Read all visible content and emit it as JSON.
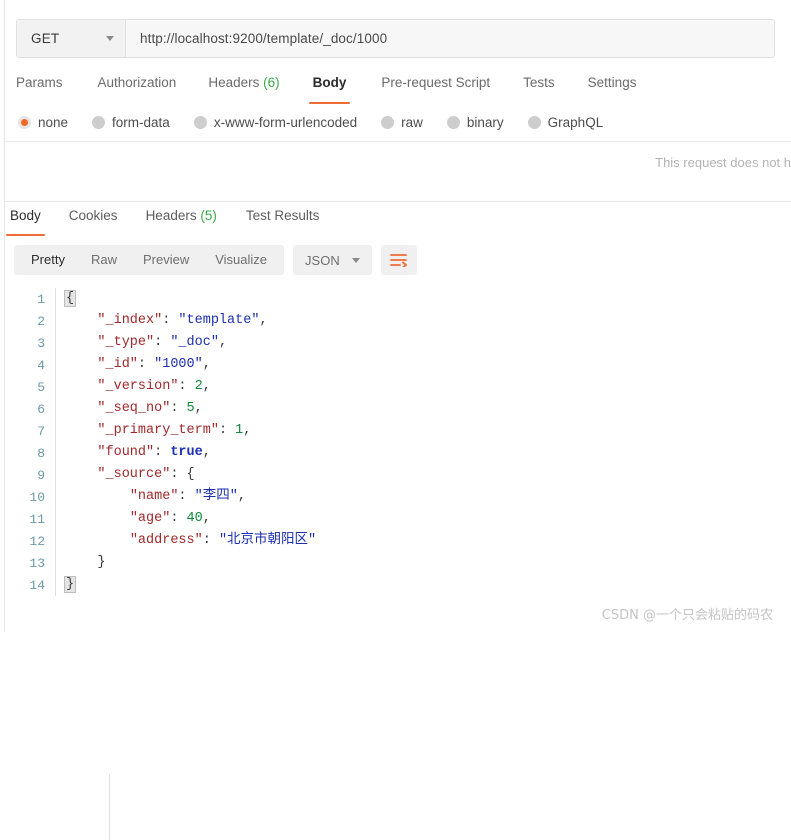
{
  "request": {
    "method": "GET",
    "url": "http://localhost:9200/template/_doc/1000",
    "tabs": [
      {
        "label": "Params",
        "count": "",
        "active": false
      },
      {
        "label": "Authorization",
        "count": "",
        "active": false
      },
      {
        "label": "Headers",
        "count": "(6)",
        "active": false
      },
      {
        "label": "Body",
        "count": "",
        "active": true
      },
      {
        "label": "Pre-request Script",
        "count": "",
        "active": false
      },
      {
        "label": "Tests",
        "count": "",
        "active": false
      },
      {
        "label": "Settings",
        "count": "",
        "active": false
      }
    ],
    "body_modes": [
      {
        "label": "none",
        "selected": true
      },
      {
        "label": "form-data",
        "selected": false
      },
      {
        "label": "x-www-form-urlencoded",
        "selected": false
      },
      {
        "label": "raw",
        "selected": false
      },
      {
        "label": "binary",
        "selected": false
      },
      {
        "label": "GraphQL",
        "selected": false
      }
    ],
    "empty_body_notice": "This request does not h"
  },
  "response": {
    "tabs": [
      {
        "label": "Body",
        "count": "",
        "active": true
      },
      {
        "label": "Cookies",
        "count": "",
        "active": false
      },
      {
        "label": "Headers",
        "count": "(5)",
        "active": false
      },
      {
        "label": "Test Results",
        "count": "",
        "active": false
      }
    ],
    "view_modes": [
      {
        "label": "Pretty",
        "active": true
      },
      {
        "label": "Raw",
        "active": false
      },
      {
        "label": "Preview",
        "active": false
      },
      {
        "label": "Visualize",
        "active": false
      }
    ],
    "format": "JSON",
    "wrap_icon": "wrap-lines-icon",
    "json_lines": [
      {
        "n": "1",
        "indent": 0,
        "tokens": [
          {
            "t": "brace-hl",
            "v": "{"
          }
        ]
      },
      {
        "n": "2",
        "indent": 1,
        "tokens": [
          {
            "t": "key",
            "v": "\"_index\""
          },
          {
            "t": "punc",
            "v": ": "
          },
          {
            "t": "str",
            "v": "\"template\""
          },
          {
            "t": "punc",
            "v": ","
          }
        ]
      },
      {
        "n": "3",
        "indent": 1,
        "tokens": [
          {
            "t": "key",
            "v": "\"_type\""
          },
          {
            "t": "punc",
            "v": ": "
          },
          {
            "t": "str",
            "v": "\"_doc\""
          },
          {
            "t": "punc",
            "v": ","
          }
        ]
      },
      {
        "n": "4",
        "indent": 1,
        "tokens": [
          {
            "t": "key",
            "v": "\"_id\""
          },
          {
            "t": "punc",
            "v": ": "
          },
          {
            "t": "str",
            "v": "\"1000\""
          },
          {
            "t": "punc",
            "v": ","
          }
        ]
      },
      {
        "n": "5",
        "indent": 1,
        "tokens": [
          {
            "t": "key",
            "v": "\"_version\""
          },
          {
            "t": "punc",
            "v": ": "
          },
          {
            "t": "num",
            "v": "2"
          },
          {
            "t": "punc",
            "v": ","
          }
        ]
      },
      {
        "n": "6",
        "indent": 1,
        "tokens": [
          {
            "t": "key",
            "v": "\"_seq_no\""
          },
          {
            "t": "punc",
            "v": ": "
          },
          {
            "t": "num",
            "v": "5"
          },
          {
            "t": "punc",
            "v": ","
          }
        ]
      },
      {
        "n": "7",
        "indent": 1,
        "tokens": [
          {
            "t": "key",
            "v": "\"_primary_term\""
          },
          {
            "t": "punc",
            "v": ": "
          },
          {
            "t": "num",
            "v": "1"
          },
          {
            "t": "punc",
            "v": ","
          }
        ]
      },
      {
        "n": "8",
        "indent": 1,
        "tokens": [
          {
            "t": "key",
            "v": "\"found\""
          },
          {
            "t": "punc",
            "v": ": "
          },
          {
            "t": "bool",
            "v": "true"
          },
          {
            "t": "punc",
            "v": ","
          }
        ]
      },
      {
        "n": "9",
        "indent": 1,
        "tokens": [
          {
            "t": "key",
            "v": "\"_source\""
          },
          {
            "t": "punc",
            "v": ": "
          },
          {
            "t": "brace",
            "v": "{"
          }
        ]
      },
      {
        "n": "10",
        "indent": 2,
        "tokens": [
          {
            "t": "key",
            "v": "\"name\""
          },
          {
            "t": "punc",
            "v": ": "
          },
          {
            "t": "str",
            "v": "\"李四\""
          },
          {
            "t": "punc",
            "v": ","
          }
        ]
      },
      {
        "n": "11",
        "indent": 2,
        "tokens": [
          {
            "t": "key",
            "v": "\"age\""
          },
          {
            "t": "punc",
            "v": ": "
          },
          {
            "t": "num",
            "v": "40"
          },
          {
            "t": "punc",
            "v": ","
          }
        ]
      },
      {
        "n": "12",
        "indent": 2,
        "tokens": [
          {
            "t": "key",
            "v": "\"address\""
          },
          {
            "t": "punc",
            "v": ": "
          },
          {
            "t": "str",
            "v": "\"北京市朝阳区\""
          }
        ]
      },
      {
        "n": "13",
        "indent": 1,
        "tokens": [
          {
            "t": "brace",
            "v": "}"
          }
        ]
      },
      {
        "n": "14",
        "indent": 0,
        "tokens": [
          {
            "t": "brace-hl",
            "v": "}"
          }
        ]
      }
    ]
  },
  "watermark": "CSDN @一个只会粘贴的码农",
  "colors": {
    "accent": "#ef6b36",
    "radio_on": "#f26722",
    "count_green": "#3aab4a",
    "json_key": "#a0282a",
    "json_string": "#1c2fb0",
    "json_number": "#0e8a3a",
    "gutter": "#6d9aa8"
  }
}
